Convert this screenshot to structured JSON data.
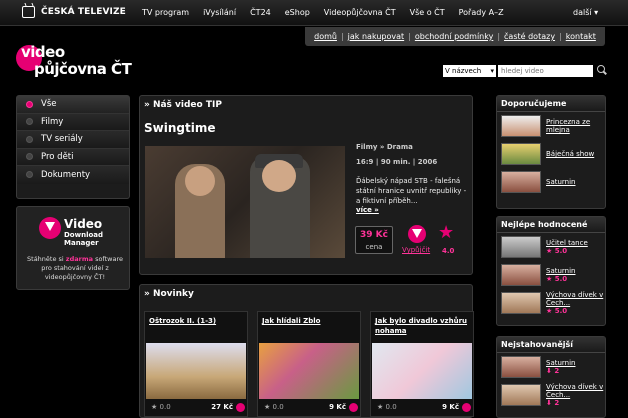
{
  "topbar": {
    "logo": "ČESKÁ TELEVIZE",
    "nav": [
      "TV program",
      "iVysílání",
      "ČT24",
      "eShop",
      "Videopůjčovna ČT",
      "Vše o ČT",
      "Pořady A–Z"
    ],
    "more": "další"
  },
  "util": [
    "domů",
    "jak nakupovat",
    "obchodní podmínky",
    "časté dotazy",
    "kontakt"
  ],
  "brand": {
    "line1": "video",
    "line2": "půjčovna ČT"
  },
  "search": {
    "select": "V názvech",
    "placeholder": "hledej video"
  },
  "leftnav": [
    "Vše",
    "Filmy",
    "TV seriály",
    "Pro děti",
    "Dokumenty"
  ],
  "download": {
    "title1": "Video",
    "title2": "Download",
    "title3": "Manager",
    "text1": "Stáhněte si",
    "text_hl": "zdarma",
    "text2": "software pro stahování videí z videopůjčovny ČT!"
  },
  "tip": {
    "section": "» Náš video TIP",
    "title": "Swingtime",
    "category": "Filmy » Drama",
    "meta": "16:9 | 90 min. | 2006",
    "desc": "Ďábelský nápad STB - falešná státní hranice uvnitř republiky - a fiktivní příběh...",
    "more": "více »",
    "price": "39 Kč",
    "price_label": "cena",
    "buy": "Vypůjčit",
    "rating": "4.0",
    "colors": {
      "accent": "#e60073"
    }
  },
  "news": {
    "section": "» Novinky",
    "cards": [
      {
        "title": "Oštrozok II. (1-3)",
        "rating": "0.0",
        "price": "27 Kč"
      },
      {
        "title": "Jak hlídali Zblo",
        "rating": "0.0",
        "price": "9 Kč"
      },
      {
        "title": "Jak bylo divadlo vzhůru nohama",
        "rating": "0.0",
        "price": "9 Kč"
      }
    ]
  },
  "popular": {
    "title": "Doporučujeme",
    "items": [
      {
        "name": "Princezna ze mlejna"
      },
      {
        "name": "Báječná show"
      },
      {
        "name": "Saturnin"
      }
    ]
  },
  "rated": {
    "title": "Nejlépe hodnocené",
    "items": [
      {
        "name": "Učitel tance",
        "score": "5.0"
      },
      {
        "name": "Saturnin",
        "score": "5.0"
      },
      {
        "name": "Výchova dívek v Čech...",
        "score": "5.0"
      }
    ]
  },
  "downloaded": {
    "title": "Nejstahovanější",
    "items": [
      {
        "name": "Saturnin",
        "score": "2"
      },
      {
        "name": "Výchova dívek v Čech...",
        "score": "2"
      }
    ]
  }
}
